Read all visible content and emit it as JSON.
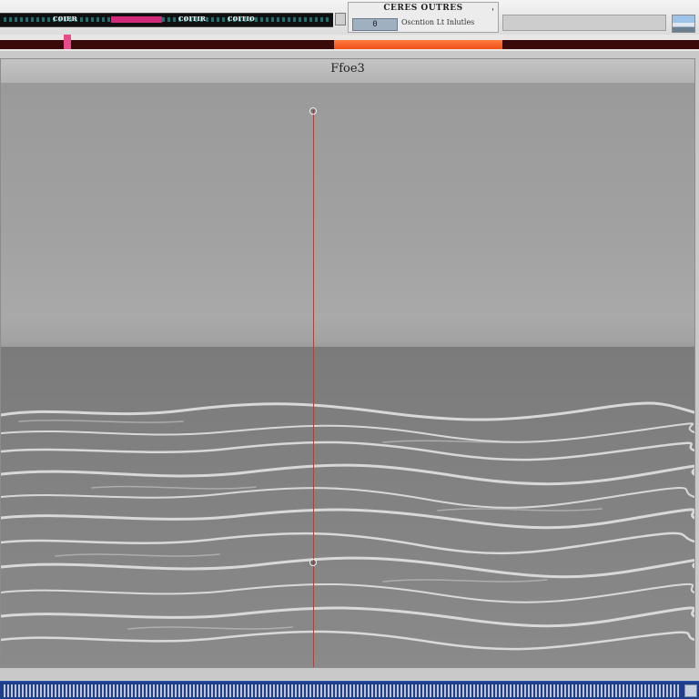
{
  "toolbar": {
    "strip_labels": [
      "ᴄᴏɪᴇʀ",
      "ᴄᴏɪᴛɪʀ",
      "ᴄᴏɪᴛɪᴏ"
    ],
    "info_title": "CERES OUTRES",
    "info_counter": "0",
    "info_detail": "Oscntion Lt Inlutles",
    "info_tick": "'"
  },
  "viewer": {
    "title": "Ffoe3"
  },
  "colors": {
    "playhead": "#e84a8a",
    "range": "#f0501a",
    "split_line": "#a2473d",
    "bottom_bar": "#1d3e8a"
  },
  "icons": {
    "thumbnail": "image-thumbnail-icon",
    "lock": "lock-icon",
    "handle": "split-handle-icon"
  }
}
